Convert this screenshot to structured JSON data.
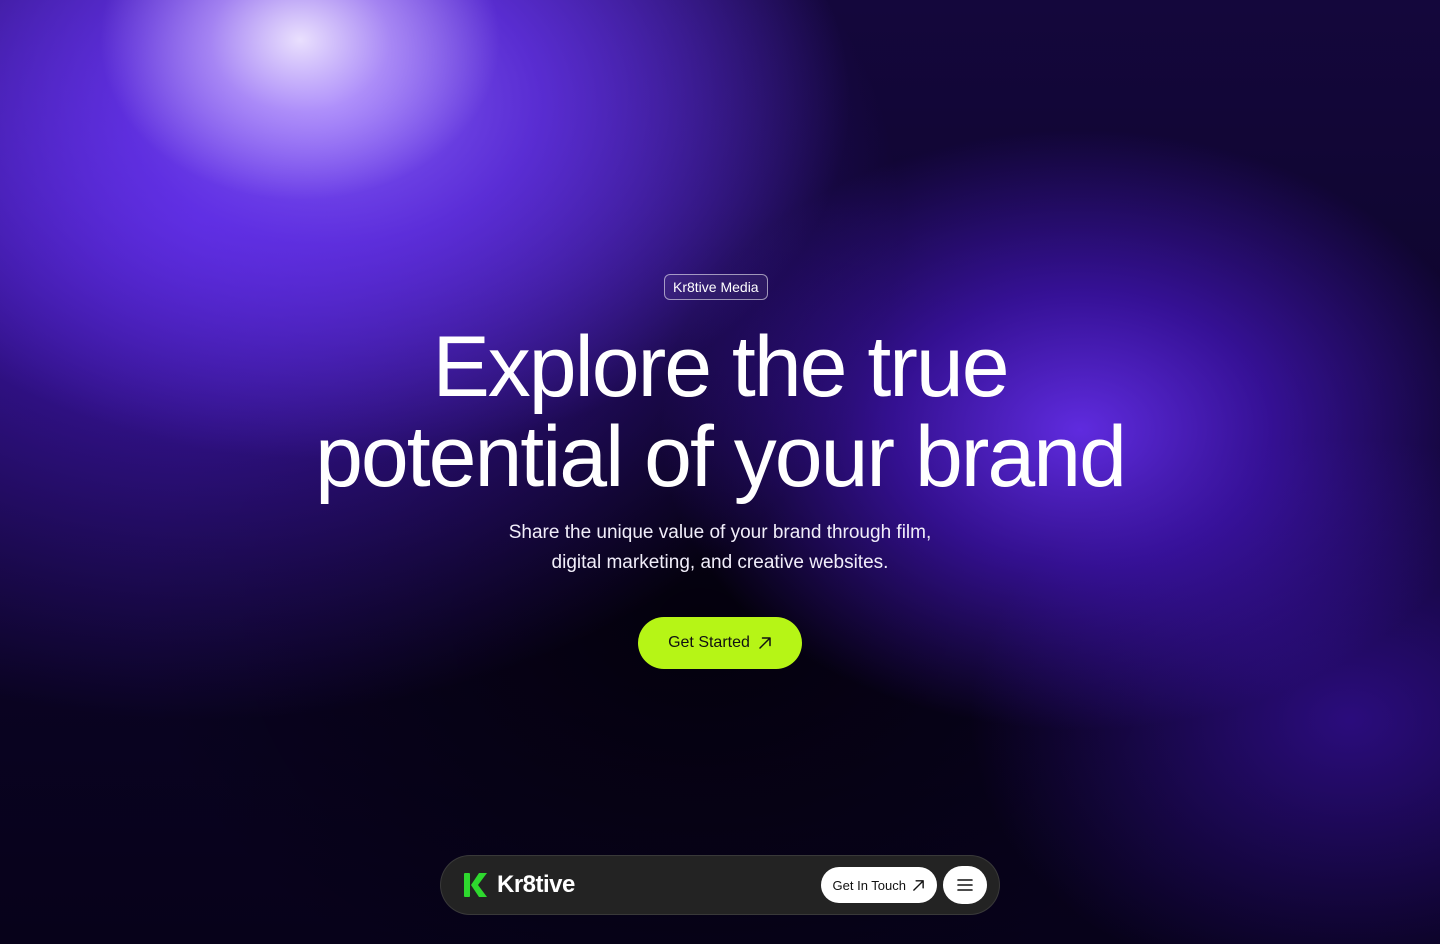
{
  "hero": {
    "tag": "Kr8tive Media",
    "headline_line1": "Explore the true",
    "headline_line2": "potential of your brand",
    "subtitle_line1": "Share the unique value of your brand through film,",
    "subtitle_line2": "digital marketing, and creative websites.",
    "cta_label": "Get Started",
    "cta_icon": "arrow-up-right-icon"
  },
  "navbar": {
    "brand_name": "Kr8tive",
    "logo_icon": "kr8tive-k-logo-icon",
    "contact_label": "Get In Touch",
    "contact_icon": "arrow-up-right-icon",
    "menu_icon": "hamburger-menu-icon"
  },
  "colors": {
    "accent": "#b6f516",
    "logo_green": "#2ed82e",
    "background_dark": "#07021a",
    "glow_purple": "#6a2cff",
    "navbar_bg": "#232323"
  }
}
